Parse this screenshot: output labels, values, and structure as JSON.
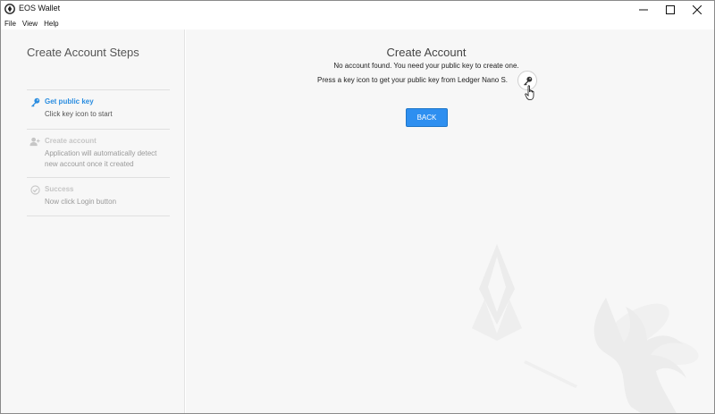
{
  "window": {
    "title": "EOS Wallet",
    "controls": {
      "minimize": "—",
      "maximize": "☐",
      "close": "✕"
    }
  },
  "menu": [
    "File",
    "View",
    "Help"
  ],
  "sidebar": {
    "title": "Create Account Steps",
    "steps": [
      {
        "title": "Get public key",
        "description": "Click key icon to start",
        "icon": "key-icon",
        "state": "active"
      },
      {
        "title": "Create account",
        "description": "Application will automatically detect new account once it created",
        "icon": "add-user-icon",
        "state": "inactive"
      },
      {
        "title": "Success",
        "description": "Now click Login button",
        "icon": "check-circle-icon",
        "state": "inactive"
      }
    ]
  },
  "main": {
    "title": "Create Account",
    "message": "No account found. You need your public key to create one.",
    "instruction": "Press a key icon to get your public key from Ledger Nano S.",
    "back_label": "BACK"
  },
  "colors": {
    "accent": "#2a8de0",
    "button": "#2e8ff0",
    "background": "#f7f7f7"
  }
}
